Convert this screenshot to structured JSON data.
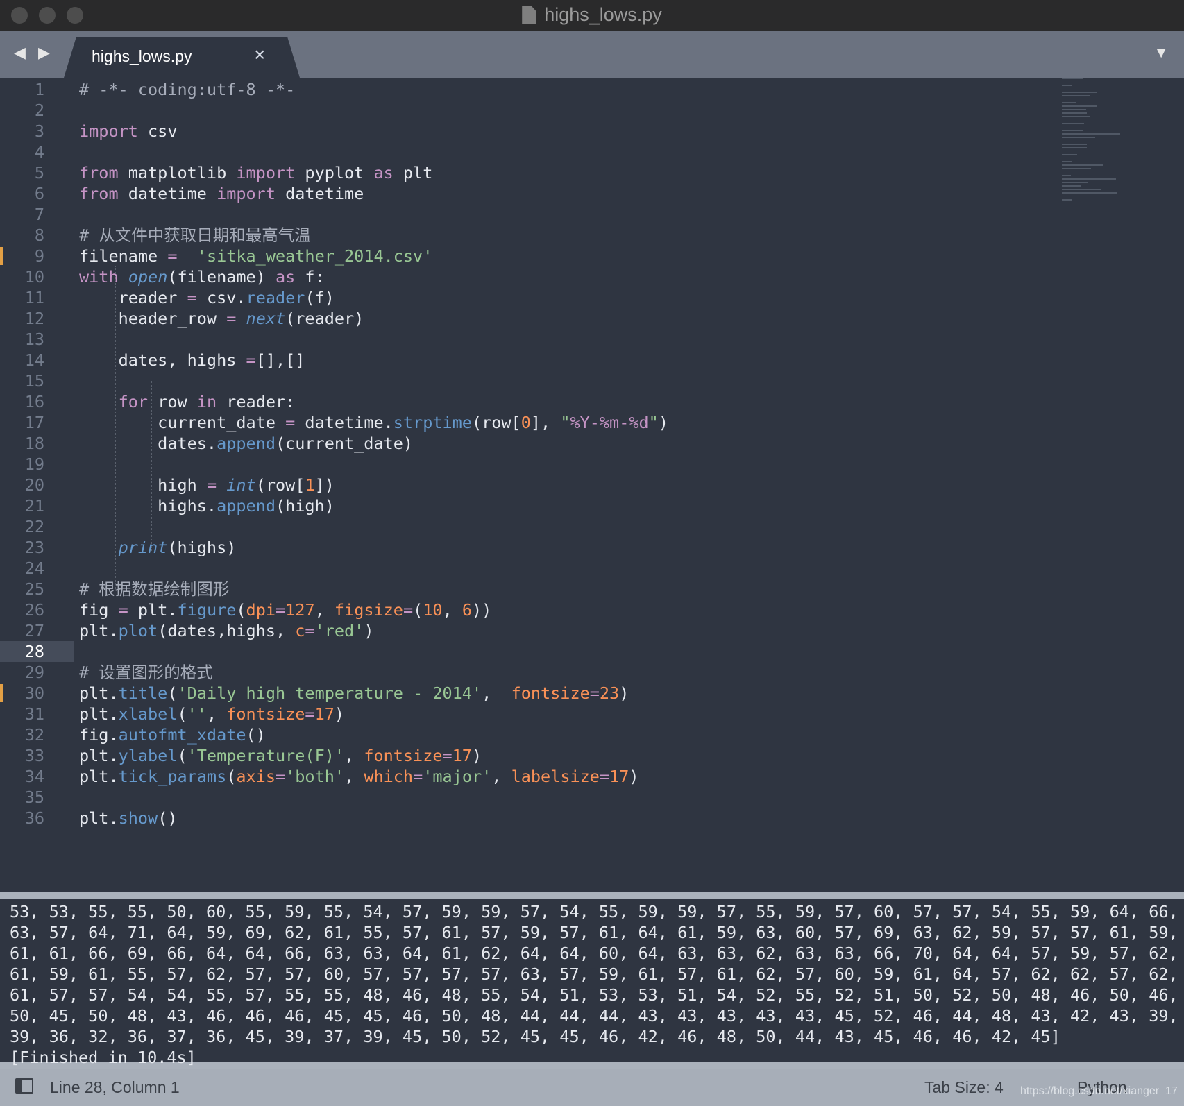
{
  "window": {
    "title": "highs_lows.py"
  },
  "tabs": [
    {
      "label": "highs_lows.py",
      "close_glyph": "×",
      "active": true
    }
  ],
  "nav": {
    "arrows": "◀ ▶",
    "dropdown_glyph": "▼"
  },
  "editor": {
    "current_line": 28,
    "marked_lines": [
      9,
      30
    ],
    "line_numbers": [
      "1",
      "2",
      "3",
      "4",
      "5",
      "6",
      "7",
      "8",
      "9",
      "10",
      "11",
      "12",
      "13",
      "14",
      "15",
      "16",
      "17",
      "18",
      "19",
      "20",
      "21",
      "22",
      "23",
      "24",
      "25",
      "26",
      "27",
      "28",
      "29",
      "30",
      "31",
      "32",
      "33",
      "34",
      "35",
      "36"
    ],
    "code_lines": [
      [
        {
          "t": "# -*- coding:utf-8 -*-",
          "c": "cmt"
        }
      ],
      [],
      [
        {
          "t": "import",
          "c": "kw"
        },
        {
          "t": " csv",
          "c": "txt"
        }
      ],
      [],
      [
        {
          "t": "from",
          "c": "kw"
        },
        {
          "t": " matplotlib ",
          "c": "txt"
        },
        {
          "t": "import",
          "c": "kw"
        },
        {
          "t": " pyplot ",
          "c": "txt"
        },
        {
          "t": "as",
          "c": "kw"
        },
        {
          "t": " plt",
          "c": "txt"
        }
      ],
      [
        {
          "t": "from",
          "c": "kw"
        },
        {
          "t": " datetime ",
          "c": "txt"
        },
        {
          "t": "import",
          "c": "kw"
        },
        {
          "t": " datetime",
          "c": "txt"
        }
      ],
      [],
      [
        {
          "t": "# 从文件中获取日期和最高气温",
          "c": "cmt"
        }
      ],
      [
        {
          "t": "filename ",
          "c": "txt"
        },
        {
          "t": "=",
          "c": "op"
        },
        {
          "t": "  ",
          "c": "txt"
        },
        {
          "t": "'sitka_weather_2014.csv'",
          "c": "str"
        }
      ],
      [
        {
          "t": "with",
          "c": "kw"
        },
        {
          "t": " ",
          "c": "txt"
        },
        {
          "t": "open",
          "c": "fni"
        },
        {
          "t": "(filename) ",
          "c": "txt"
        },
        {
          "t": "as",
          "c": "kw"
        },
        {
          "t": " f:",
          "c": "txt"
        }
      ],
      [
        {
          "t": "    reader ",
          "c": "txt"
        },
        {
          "t": "=",
          "c": "op"
        },
        {
          "t": " csv.",
          "c": "txt"
        },
        {
          "t": "reader",
          "c": "fn"
        },
        {
          "t": "(f)",
          "c": "txt"
        }
      ],
      [
        {
          "t": "    header_row ",
          "c": "txt"
        },
        {
          "t": "=",
          "c": "op"
        },
        {
          "t": " ",
          "c": "txt"
        },
        {
          "t": "next",
          "c": "fni"
        },
        {
          "t": "(reader)",
          "c": "txt"
        }
      ],
      [],
      [
        {
          "t": "    dates, highs ",
          "c": "txt"
        },
        {
          "t": "=",
          "c": "op"
        },
        {
          "t": "[],[]",
          "c": "txt"
        }
      ],
      [],
      [
        {
          "t": "    ",
          "c": "txt"
        },
        {
          "t": "for",
          "c": "kw"
        },
        {
          "t": " row ",
          "c": "txt"
        },
        {
          "t": "in",
          "c": "kw"
        },
        {
          "t": " reader:",
          "c": "txt"
        }
      ],
      [
        {
          "t": "        current_date ",
          "c": "txt"
        },
        {
          "t": "=",
          "c": "op"
        },
        {
          "t": " datetime.",
          "c": "txt"
        },
        {
          "t": "strptime",
          "c": "fn"
        },
        {
          "t": "(row[",
          "c": "txt"
        },
        {
          "t": "0",
          "c": "num"
        },
        {
          "t": "], ",
          "c": "txt"
        },
        {
          "t": "\"",
          "c": "str"
        },
        {
          "t": "%Y-%m-%d",
          "c": "kw"
        },
        {
          "t": "\"",
          "c": "str"
        },
        {
          "t": ")",
          "c": "txt"
        }
      ],
      [
        {
          "t": "        dates.",
          "c": "txt"
        },
        {
          "t": "append",
          "c": "fn"
        },
        {
          "t": "(current_date)",
          "c": "txt"
        }
      ],
      [],
      [
        {
          "t": "        high ",
          "c": "txt"
        },
        {
          "t": "=",
          "c": "op"
        },
        {
          "t": " ",
          "c": "txt"
        },
        {
          "t": "int",
          "c": "fni"
        },
        {
          "t": "(row[",
          "c": "txt"
        },
        {
          "t": "1",
          "c": "num"
        },
        {
          "t": "])",
          "c": "txt"
        }
      ],
      [
        {
          "t": "        highs.",
          "c": "txt"
        },
        {
          "t": "append",
          "c": "fn"
        },
        {
          "t": "(high)",
          "c": "txt"
        }
      ],
      [],
      [
        {
          "t": "    ",
          "c": "txt"
        },
        {
          "t": "print",
          "c": "fni"
        },
        {
          "t": "(highs)",
          "c": "txt"
        }
      ],
      [],
      [
        {
          "t": "# 根据数据绘制图形",
          "c": "cmt"
        }
      ],
      [
        {
          "t": "fig ",
          "c": "txt"
        },
        {
          "t": "=",
          "c": "op"
        },
        {
          "t": " plt.",
          "c": "txt"
        },
        {
          "t": "figure",
          "c": "fn"
        },
        {
          "t": "(",
          "c": "txt"
        },
        {
          "t": "dpi",
          "c": "prm"
        },
        {
          "t": "=",
          "c": "op"
        },
        {
          "t": "127",
          "c": "num"
        },
        {
          "t": ", ",
          "c": "txt"
        },
        {
          "t": "figsize",
          "c": "prm"
        },
        {
          "t": "=",
          "c": "op"
        },
        {
          "t": "(",
          "c": "txt"
        },
        {
          "t": "10",
          "c": "num"
        },
        {
          "t": ", ",
          "c": "txt"
        },
        {
          "t": "6",
          "c": "num"
        },
        {
          "t": "))",
          "c": "txt"
        }
      ],
      [
        {
          "t": "plt.",
          "c": "txt"
        },
        {
          "t": "plot",
          "c": "fn"
        },
        {
          "t": "(dates,highs, ",
          "c": "txt"
        },
        {
          "t": "c",
          "c": "prm"
        },
        {
          "t": "=",
          "c": "op"
        },
        {
          "t": "'red'",
          "c": "str"
        },
        {
          "t": ")",
          "c": "txt"
        }
      ],
      [],
      [
        {
          "t": "# 设置图形的格式",
          "c": "cmt"
        }
      ],
      [
        {
          "t": "plt.",
          "c": "txt"
        },
        {
          "t": "title",
          "c": "fn"
        },
        {
          "t": "(",
          "c": "txt"
        },
        {
          "t": "'Daily high temperature - 2014'",
          "c": "str"
        },
        {
          "t": ",  ",
          "c": "txt"
        },
        {
          "t": "fontsize",
          "c": "prm"
        },
        {
          "t": "=",
          "c": "op"
        },
        {
          "t": "23",
          "c": "num"
        },
        {
          "t": ")",
          "c": "txt"
        }
      ],
      [
        {
          "t": "plt.",
          "c": "txt"
        },
        {
          "t": "xlabel",
          "c": "fn"
        },
        {
          "t": "(",
          "c": "txt"
        },
        {
          "t": "''",
          "c": "str"
        },
        {
          "t": ", ",
          "c": "txt"
        },
        {
          "t": "fontsize",
          "c": "prm"
        },
        {
          "t": "=",
          "c": "op"
        },
        {
          "t": "17",
          "c": "num"
        },
        {
          "t": ")",
          "c": "txt"
        }
      ],
      [
        {
          "t": "fig.",
          "c": "txt"
        },
        {
          "t": "autofmt_xdate",
          "c": "fn"
        },
        {
          "t": "()",
          "c": "txt"
        }
      ],
      [
        {
          "t": "plt.",
          "c": "txt"
        },
        {
          "t": "ylabel",
          "c": "fn"
        },
        {
          "t": "(",
          "c": "txt"
        },
        {
          "t": "'Temperature(F)'",
          "c": "str"
        },
        {
          "t": ", ",
          "c": "txt"
        },
        {
          "t": "fontsize",
          "c": "prm"
        },
        {
          "t": "=",
          "c": "op"
        },
        {
          "t": "17",
          "c": "num"
        },
        {
          "t": ")",
          "c": "txt"
        }
      ],
      [
        {
          "t": "plt.",
          "c": "txt"
        },
        {
          "t": "tick_params",
          "c": "fn"
        },
        {
          "t": "(",
          "c": "txt"
        },
        {
          "t": "axis",
          "c": "prm"
        },
        {
          "t": "=",
          "c": "op"
        },
        {
          "t": "'both'",
          "c": "str"
        },
        {
          "t": ", ",
          "c": "txt"
        },
        {
          "t": "which",
          "c": "prm"
        },
        {
          "t": "=",
          "c": "op"
        },
        {
          "t": "'major'",
          "c": "str"
        },
        {
          "t": ", ",
          "c": "txt"
        },
        {
          "t": "labelsize",
          "c": "prm"
        },
        {
          "t": "=",
          "c": "op"
        },
        {
          "t": "17",
          "c": "num"
        },
        {
          "t": ")",
          "c": "txt"
        }
      ],
      [],
      [
        {
          "t": "plt.",
          "c": "txt"
        },
        {
          "t": "show",
          "c": "fn"
        },
        {
          "t": "()",
          "c": "txt"
        }
      ]
    ]
  },
  "output": {
    "lines": [
      "53, 53, 55, 55, 50, 60, 55, 59, 55, 54, 57, 59, 59, 57, 54, 55, 59, 59, 57, 55, 59, 57, 60, 57, 57, 54, 55, 59, 64, 66,",
      "63, 57, 64, 71, 64, 59, 69, 62, 61, 55, 57, 61, 57, 59, 57, 61, 64, 61, 59, 63, 60, 57, 69, 63, 62, 59, 57, 57, 61, 59,",
      "61, 61, 66, 69, 66, 64, 64, 66, 63, 63, 64, 61, 62, 64, 64, 60, 64, 63, 63, 62, 63, 63, 66, 70, 64, 64, 57, 59, 57, 62,",
      "61, 59, 61, 55, 57, 62, 57, 57, 60, 57, 57, 57, 57, 63, 57, 59, 61, 57, 61, 62, 57, 60, 59, 61, 64, 57, 62, 62, 57, 62,",
      "61, 57, 57, 54, 54, 55, 57, 55, 55, 48, 46, 48, 55, 54, 51, 53, 53, 51, 54, 52, 55, 52, 51, 50, 52, 50, 48, 46, 50, 46,",
      "50, 45, 50, 48, 43, 46, 46, 46, 45, 45, 46, 50, 48, 44, 44, 44, 43, 43, 43, 43, 43, 45, 52, 46, 44, 48, 43, 42, 43, 39,",
      "39, 36, 32, 36, 37, 36, 45, 39, 37, 39, 45, 50, 52, 45, 45, 46, 42, 46, 48, 50, 44, 43, 45, 46, 46, 42, 45]",
      "[Finished in 10.4s]"
    ]
  },
  "status": {
    "position": "Line 28, Column 1",
    "tab_size": "Tab Size: 4",
    "syntax": "Python",
    "watermark": "https://blog.csdn.net/xianger_17"
  },
  "colors": {
    "background": "#2f3541",
    "keyword": "#c594c5",
    "function": "#6699cc",
    "string": "#99c794",
    "number": "#f99157",
    "comment": "#a7adba",
    "gutter_marker": "#e3a045"
  }
}
